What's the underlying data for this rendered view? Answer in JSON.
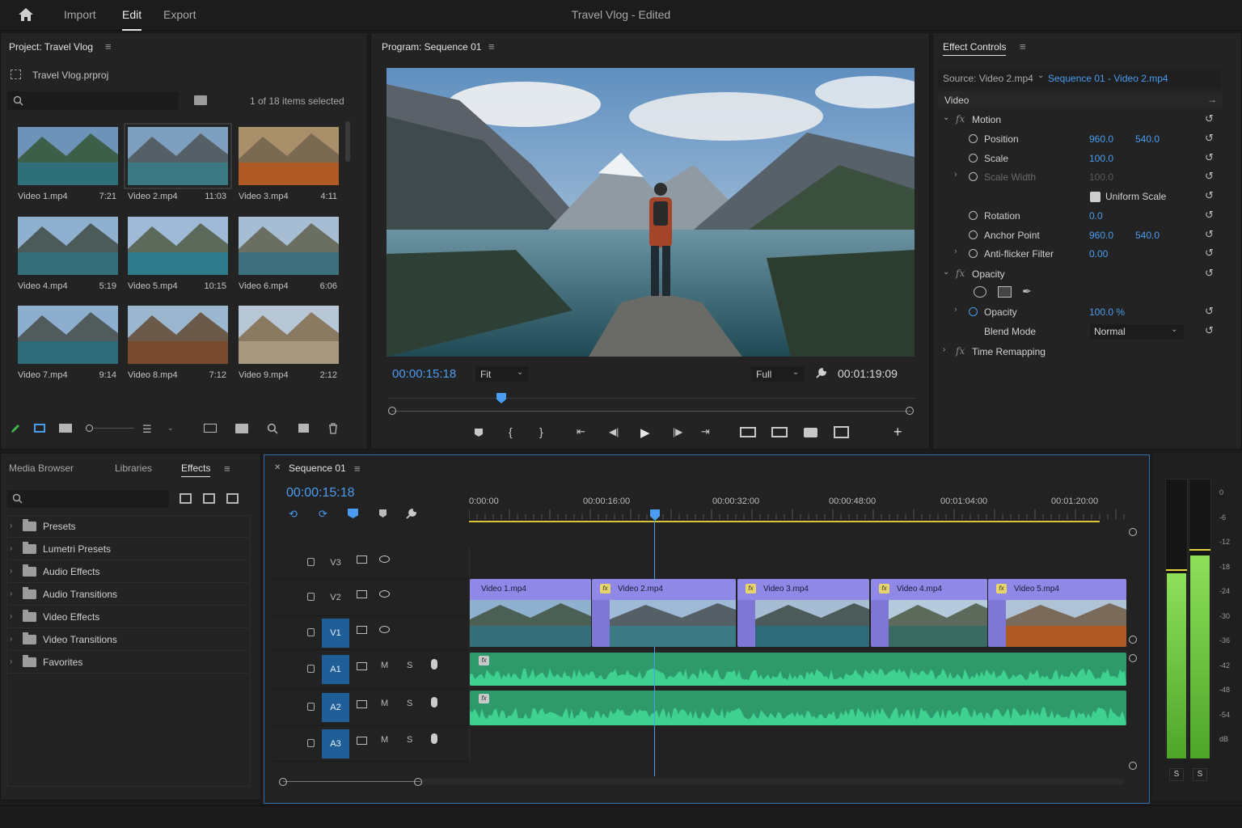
{
  "top": {
    "home": "home",
    "tabs": [
      "Import",
      "Edit",
      "Export"
    ],
    "active_tab": "Edit",
    "title": "Travel Vlog - Edited"
  },
  "project": {
    "title": "Project: Travel Vlog",
    "file": "Travel Vlog.prproj",
    "search_placeholder": "",
    "selection": "1 of 18 items selected",
    "items": [
      {
        "name": "Video 1.mp4",
        "duration": "7:21"
      },
      {
        "name": "Video 2.mp4",
        "duration": "11:03"
      },
      {
        "name": "Video 3.mp4",
        "duration": "4:11"
      },
      {
        "name": "Video 4.mp4",
        "duration": "5:19"
      },
      {
        "name": "Video 5.mp4",
        "duration": "10:15"
      },
      {
        "name": "Video 6.mp4",
        "duration": "6:06"
      },
      {
        "name": "Video 7.mp4",
        "duration": "9:14"
      },
      {
        "name": "Video 8.mp4",
        "duration": "7:12"
      },
      {
        "name": "Video 9.mp4",
        "duration": "2:12"
      }
    ]
  },
  "program": {
    "title": "Program: Sequence 01",
    "timecode": "00:00:15:18",
    "fit": "Fit",
    "quality": "Full",
    "duration": "00:01:19:09"
  },
  "effect_controls": {
    "title": "Effect Controls",
    "source": "Source: Video 2.mp4",
    "sequence": "Sequence 01 - Video 2.mp4",
    "section": "Video",
    "motion": "Motion",
    "rows": {
      "position": {
        "label": "Position",
        "x": "960.0",
        "y": "540.0"
      },
      "scale": {
        "label": "Scale",
        "value": "100.0"
      },
      "scale_width": {
        "label": "Scale Width",
        "value": "100.0"
      },
      "uniform": "Uniform Scale",
      "rotation": {
        "label": "Rotation",
        "value": "0.0"
      },
      "anchor": {
        "label": "Anchor Point",
        "x": "960.0",
        "y": "540.0"
      },
      "antiflicker": {
        "label": "Anti-flicker Filter",
        "value": "0.00"
      }
    },
    "opacity_group": "Opacity",
    "opacity": {
      "label": "Opacity",
      "value": "100.0 %"
    },
    "blend": {
      "label": "Blend Mode",
      "value": "Normal"
    },
    "time_remap": "Time Remapping"
  },
  "effects_panel": {
    "tabs": [
      "Media Browser",
      "Libraries",
      "Effects"
    ],
    "active_tab": "Effects",
    "items": [
      "Presets",
      "Lumetri Presets",
      "Audio Effects",
      "Audio Transitions",
      "Video Effects",
      "Video Transitions",
      "Favorites"
    ]
  },
  "timeline": {
    "title": "Sequence 01",
    "timecode": "00:00:15:18",
    "ruler": [
      "0:00:00",
      "00:00:16:00",
      "00:00:32:00",
      "00:00:48:00",
      "00:01:04:00",
      "00:01:20:00"
    ],
    "tracks": {
      "v3": "V3",
      "v2": "V2",
      "v1": "V1",
      "a1": "A1",
      "a2": "A2",
      "a3": "A3",
      "m": "M",
      "s": "S"
    },
    "clips": [
      "Video 1.mp4",
      "Video 2.mp4",
      "Video 3.mp4",
      "Video 4.mp4",
      "Video 5.mp4"
    ],
    "fx": "fx"
  },
  "meter": {
    "scale": [
      "0",
      "-6",
      "-12",
      "-18",
      "-24",
      "-30",
      "-36",
      "-42",
      "-48",
      "-54",
      "dB"
    ],
    "solo": [
      "S",
      "S"
    ]
  },
  "colors": {
    "accent": "#4a9cf0",
    "clip": "#8f88e6",
    "audio": "#2f9e6e",
    "playhead": "#4a9cf0",
    "work_area": "#d8c43a",
    "meter": "#6fbf3a"
  }
}
